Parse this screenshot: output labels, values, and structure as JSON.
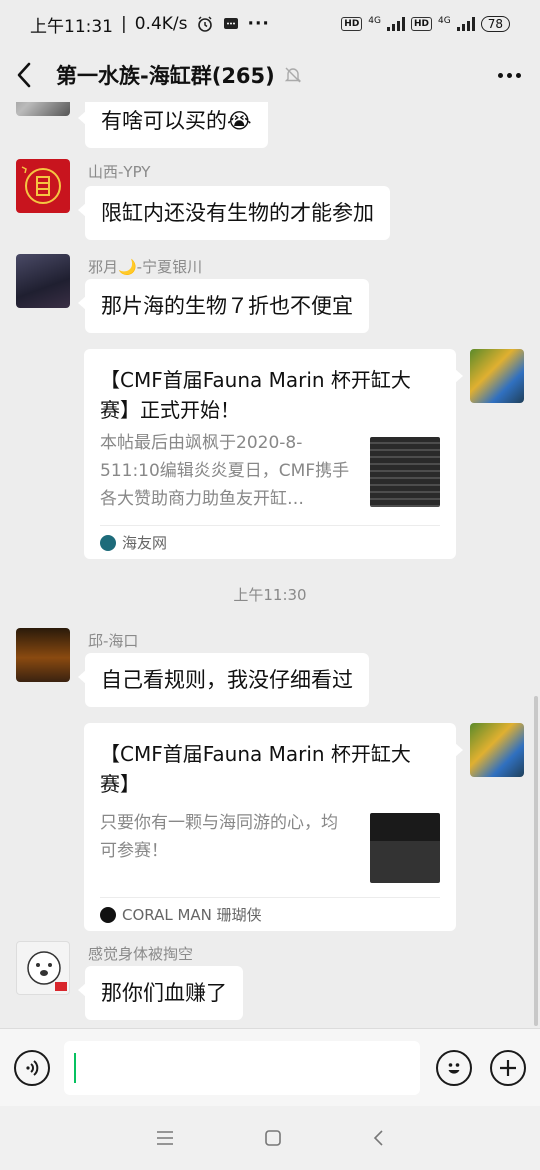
{
  "status": {
    "time": "上午11:31",
    "speed": "0.4K/s",
    "hd1": "HD",
    "hd2": "HD",
    "net1": "4G",
    "net2": "4G",
    "battery": "78"
  },
  "header": {
    "title": "第一水族-海缸群(265)"
  },
  "messages": {
    "m0": {
      "text": "有啥可以买的😭"
    },
    "m1": {
      "sender": "山西-YPY",
      "text": "限缸内还没有生物的才能参加"
    },
    "m2": {
      "sender": "邪月🌙-宁夏银川",
      "text": "那片海的生物７折也不便宜"
    },
    "card1": {
      "title": "【CMF首届Fauna Marin 杯开缸大赛】正式开始！",
      "desc": "本帖最后由飒枫于2020-8-511:10编辑炎炎夏日，CMF携手各大赞助商力助鱼友开缸…",
      "source": "海友网"
    },
    "time_sep": "上午11:30",
    "m3": {
      "sender": "邱-海口",
      "text": "自己看规则，我没仔细看过"
    },
    "card2": {
      "title": "【CMF首届Fauna Marin 杯开缸大赛】",
      "desc": "只要你有一颗与海同游的心，均可参赛！",
      "source": "CORAL MAN 珊瑚侠"
    },
    "m4": {
      "sender": "感觉身体被掏空",
      "text": "那你们血赚了"
    }
  },
  "colors": {
    "background": "#ededed",
    "bubble": "#ffffff",
    "caret": "#07c160",
    "secondary_text": "#8a8a8a"
  },
  "icons": {
    "back": "chevron-left-icon",
    "mute": "bell-off-icon",
    "more": "ellipsis-icon",
    "voice": "voice-icon",
    "emoji": "smile-icon",
    "plus": "plus-icon"
  }
}
